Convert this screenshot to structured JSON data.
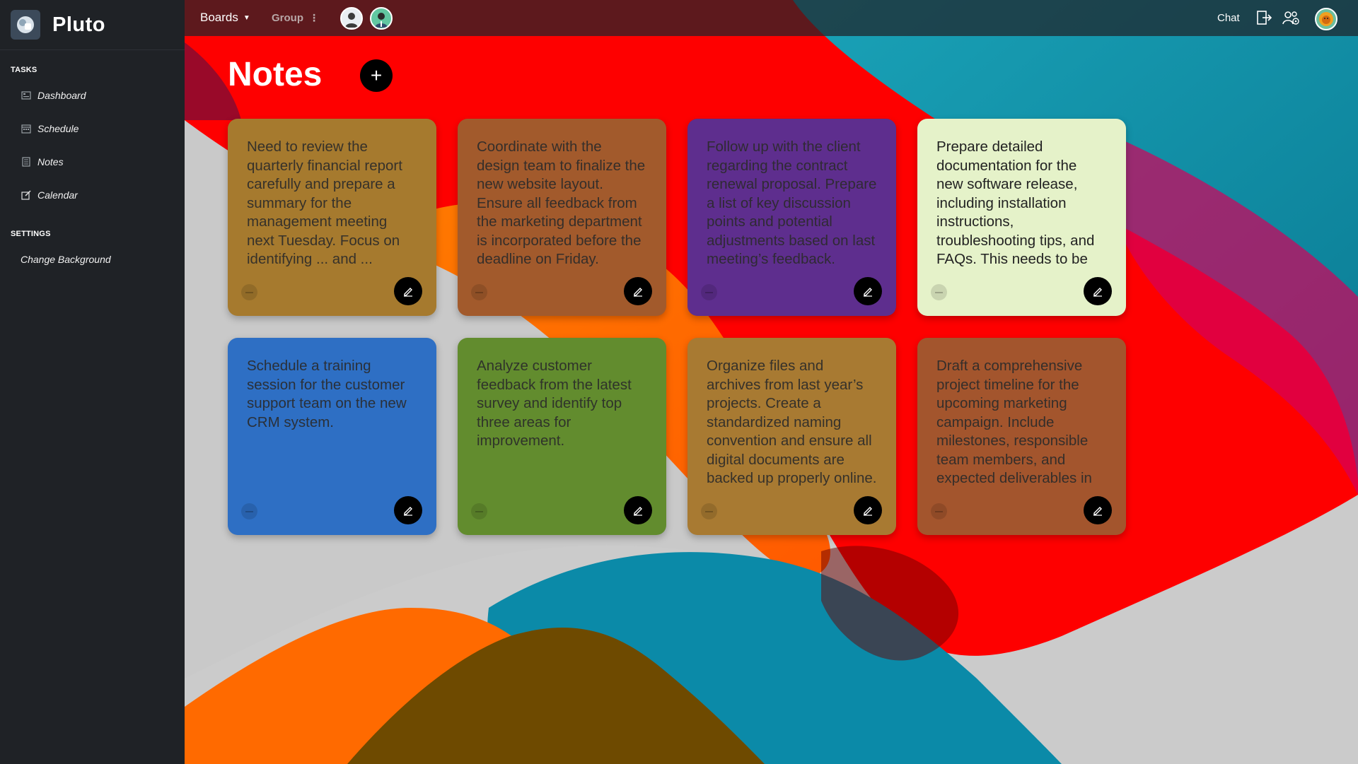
{
  "app": {
    "name": "Pluto"
  },
  "sidebar": {
    "sections": [
      {
        "title": "TASKS",
        "items": [
          {
            "label": "Dashboard",
            "icon": "dashboard-icon"
          },
          {
            "label": "Schedule",
            "icon": "schedule-icon"
          },
          {
            "label": "Notes",
            "icon": "notes-icon"
          },
          {
            "label": "Calendar",
            "icon": "calendar-edit-icon"
          }
        ]
      },
      {
        "title": "SETTINGS",
        "items": [
          {
            "label": "Change Background"
          }
        ]
      }
    ]
  },
  "topbar": {
    "boards_label": "Boards",
    "group_label": "Group",
    "chat_label": "Chat"
  },
  "main": {
    "title": "Notes",
    "add_label": "+"
  },
  "notes": [
    {
      "text": "Need to review the quarterly financial report carefully and prepare a summary for the management meeting next Tuesday. Focus on identifying ... and ...",
      "color": "#a67a2e"
    },
    {
      "text": "Coordinate with the design team to finalize the new website layout. Ensure all feedback from the marketing department is incorporated before the deadline on Friday.",
      "color": "#a25a2c"
    },
    {
      "text": "Follow up with the client regarding the contract renewal proposal. Prepare a list of key discussion points and potential adjustments based on last meeting’s feedback.",
      "color": "#5e2e8e"
    },
    {
      "text": "Prepare detailed documentation for the new software release, including installation instructions, troubleshooting tips, and FAQs. This needs to be ready before the launch.",
      "color": "#e5f2c9"
    },
    {
      "text": "Schedule a training session for the customer support team on the new CRM system.",
      "color": "#2e6fc4"
    },
    {
      "text": "Analyze customer feedback from the latest survey and identify top three areas for improvement.",
      "color": "#628c2e"
    },
    {
      "text": "Organize files and archives from last year’s projects. Create a standardized naming convention and ensure all digital documents are backed up properly online.",
      "color": "#a87a32"
    },
    {
      "text": "Draft a comprehensive project timeline for the upcoming marketing campaign. Include milestones, responsible team members, and expected deliverables in the plan.",
      "color": "#a3552d"
    }
  ]
}
